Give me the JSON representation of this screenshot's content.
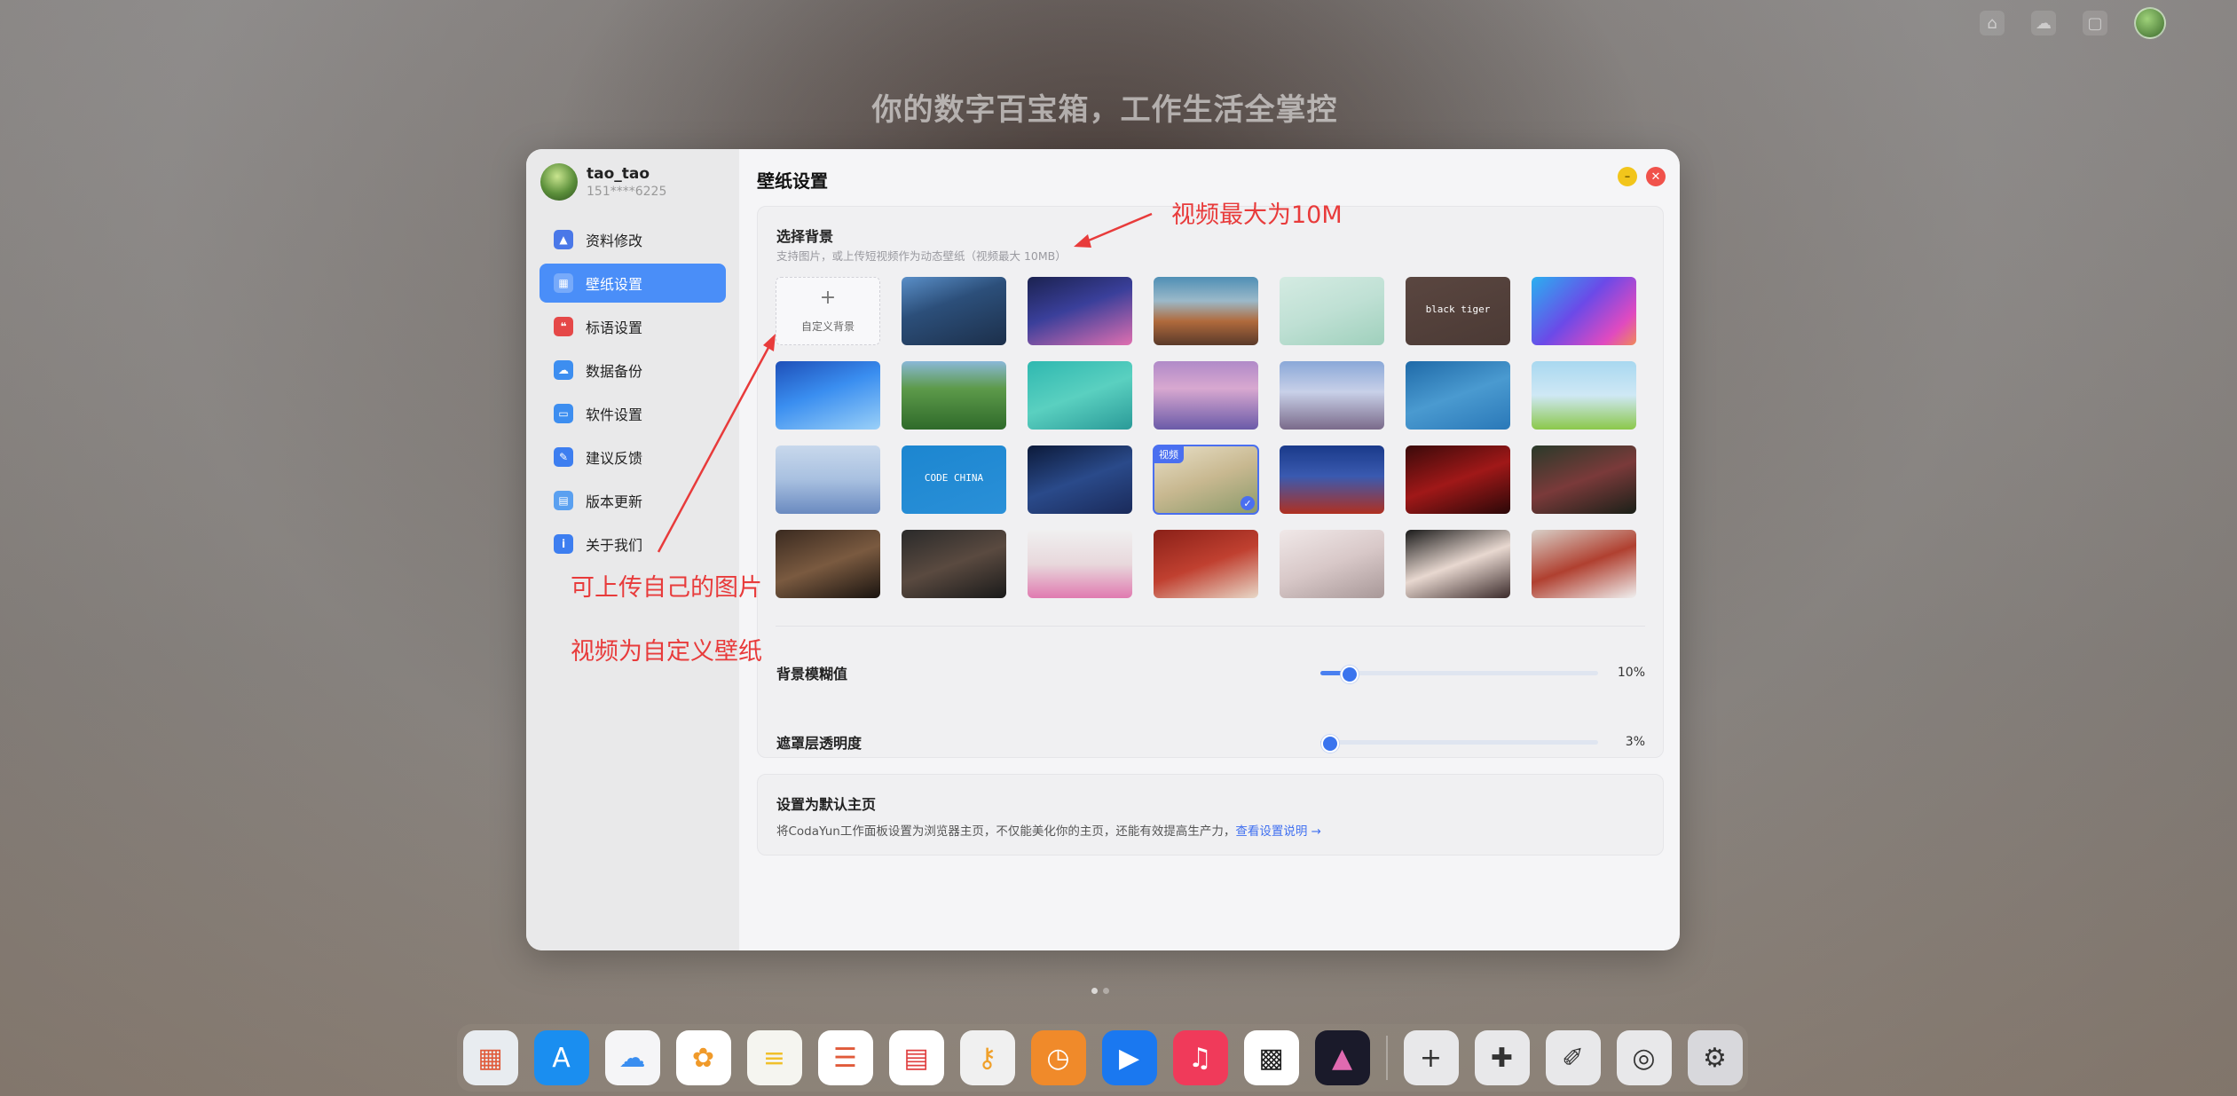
{
  "slogan": "你的数字百宝箱，工作生活全掌控",
  "profile": {
    "name": "tao_tao",
    "phone": "151****6225"
  },
  "menu": [
    {
      "label": "资料修改",
      "icon": "user-edit-icon",
      "color": "#4a78e8",
      "glyph": "▲",
      "active": false
    },
    {
      "label": "壁纸设置",
      "icon": "wallpaper-icon",
      "color": "#ffffff",
      "glyph": "▦",
      "active": true
    },
    {
      "label": "标语设置",
      "icon": "quote-icon",
      "color": "#e54848",
      "glyph": "❝",
      "active": false
    },
    {
      "label": "数据备份",
      "icon": "cloud-icon",
      "color": "#3d8ef0",
      "glyph": "☁",
      "active": false
    },
    {
      "label": "软件设置",
      "icon": "computer-icon",
      "color": "#3d8ef0",
      "glyph": "▭",
      "active": false
    },
    {
      "label": "建议反馈",
      "icon": "feedback-icon",
      "color": "#3d7ef0",
      "glyph": "✎",
      "active": false
    },
    {
      "label": "版本更新",
      "icon": "update-icon",
      "color": "#5aa0f0",
      "glyph": "▤",
      "active": false
    },
    {
      "label": "关于我们",
      "icon": "info-icon",
      "color": "#3d7ef0",
      "glyph": "i",
      "active": false
    }
  ],
  "main": {
    "title": "壁纸设置",
    "select": {
      "title": "选择背景",
      "subtitle": "支持图片，或上传短视频作为动态壁纸（视频最大 10MB）",
      "add_label": "自定义背景",
      "add_plus": "+",
      "video_badge": "视频",
      "selected_index": 24,
      "tiles": [
        {
          "name": "anime-city",
          "bg": "linear-gradient(160deg,#5a8fc8 0%,#2c4f7a 40%,#1c2f4a 100%)"
        },
        {
          "name": "neon-night-city",
          "bg": "linear-gradient(160deg,#1b2250 0%,#3a3f9a 45%,#e06fb0 100%)"
        },
        {
          "name": "mountain-sunset",
          "bg": "linear-gradient(180deg,#4f8fb5 0%,#9bb9c9 35%,#b06a3c 65%,#5a3a2a 100%)"
        },
        {
          "name": "green-cartoon",
          "bg": "linear-gradient(160deg,#d4ebe2 0%,#bfe0d4 50%,#9fd0bc 100%)"
        },
        {
          "name": "black-tiger-text",
          "bg": "linear-gradient(160deg,#5a4640 0%,#4b3a35 100%)",
          "text": "black tiger"
        },
        {
          "name": "purple-gradient",
          "bg": "linear-gradient(135deg,#2ab0f0 0%,#6b4ae8 45%,#e04ac0 80%,#f08a5a 100%)"
        },
        {
          "name": "blue-waves",
          "bg": "linear-gradient(160deg,#1e4fb8 0%,#3a8ef0 45%,#9ad0f8 100%)"
        },
        {
          "name": "green-forest",
          "bg": "linear-gradient(180deg,#8ab8d8 0%,#5d9a4a 40%,#2f6a2a 100%)"
        },
        {
          "name": "teal-texture",
          "bg": "linear-gradient(160deg,#2fb8b0 0%,#5ad0c0 50%,#2a9a98 100%)"
        },
        {
          "name": "mount-fuji-purple",
          "bg": "linear-gradient(180deg,#b08ac8 0%,#d8a8d0 40%,#6a5aa8 100%)"
        },
        {
          "name": "mount-fuji-sakura",
          "bg": "linear-gradient(180deg,#8aa8d8 0%,#c8d0e8 45%,#7a6a8a 100%)"
        },
        {
          "name": "blue-water",
          "bg": "linear-gradient(160deg,#1f6aa8 0%,#4a9ad0 50%,#2a78b8 100%)"
        },
        {
          "name": "pixel-cartoon",
          "bg": "linear-gradient(180deg,#a8d8f0 0%,#cfe8f5 50%,#8bc84a 100%)"
        },
        {
          "name": "misty-mountains",
          "bg": "linear-gradient(180deg,#c8d8ec 0%,#a8c0e0 50%,#6a8ac0 100%)"
        },
        {
          "name": "code-screen",
          "bg": "linear-gradient(160deg,#1c86d0 0%,#2a90d8 100%)",
          "text": "CODE CHINA"
        },
        {
          "name": "stage-concert",
          "bg": "linear-gradient(160deg,#0c1a3a 0%,#2a4a8a 50%,#1a2a5a 100%)"
        },
        {
          "name": "girl-video",
          "bg": "linear-gradient(160deg,#e8e0c8 0%,#c8b890 50%,#8a9a6a 100%)"
        },
        {
          "name": "tiananmen",
          "bg": "linear-gradient(180deg,#1a3a8a 0%,#3a5ab0 45%,#b03020 100%)"
        },
        {
          "name": "red-dark",
          "bg": "linear-gradient(160deg,#3a0a0a 0%,#a01818 50%,#2a0808 100%)"
        },
        {
          "name": "woman-red-dress",
          "bg": "linear-gradient(160deg,#2a3a2a 0%,#7a3a3a 50%,#1a2018 100%)"
        },
        {
          "name": "woman-portrait-dark",
          "bg": "linear-gradient(160deg,#3a2a20 0%,#7a5a40 50%,#1a1410 100%)"
        },
        {
          "name": "woman-black",
          "bg": "linear-gradient(160deg,#2a2a2a 0%,#5a4a40 50%,#1a1a1a 100%)"
        },
        {
          "name": "woman-pink",
          "bg": "linear-gradient(180deg,#f0f0f0 0%,#e8d8dc 50%,#e07ab0 100%)"
        },
        {
          "name": "cat-red-corridor",
          "bg": "linear-gradient(160deg,#8a2018 0%,#c04030 50%,#e8d8c8 100%)"
        },
        {
          "name": "woman-white",
          "bg": "linear-gradient(160deg,#f0e8e8 0%,#d8c8c8 50%,#a89898 100%)"
        },
        {
          "name": "woman-hanfu",
          "bg": "linear-gradient(160deg,#1a1a1a 0%,#e8d8d0 50%,#3a2a2a 100%)"
        },
        {
          "name": "cat-snow",
          "bg": "linear-gradient(160deg,#d8d0c8 0%,#b04030 50%,#f0f0f0 100%)"
        }
      ]
    },
    "blur": {
      "label": "背景模糊值",
      "value": 10,
      "display": "10%"
    },
    "overlay": {
      "label": "遮罩层透明度",
      "value": 3,
      "display": "3%"
    },
    "default_home": {
      "title": "设置为默认主页",
      "desc": "将CodaYun工作面板设置为浏览器主页，不仅能美化你的主页，还能有效提高生产力，",
      "link": "查看设置说明 →"
    }
  },
  "annotations": {
    "video_max": "视频最大为10M",
    "upload_own": "可上传自己的图片",
    "video_custom": "视频为自定义壁纸"
  },
  "dock": [
    {
      "name": "launchpad-icon",
      "bg": "#e8ecf0",
      "glyph": "▦",
      "color": "#e05a3a"
    },
    {
      "name": "appstore-icon",
      "bg": "#1a8ef0",
      "glyph": "A",
      "color": "#ffffff"
    },
    {
      "name": "icloud-icon",
      "bg": "#f5f5f7",
      "glyph": "☁",
      "color": "#3a8ef0"
    },
    {
      "name": "photos-icon",
      "bg": "#ffffff",
      "glyph": "✿",
      "color": "#f09a2a"
    },
    {
      "name": "notes-icon",
      "bg": "#f5f5f0",
      "glyph": "≡",
      "color": "#f0c02a"
    },
    {
      "name": "reminders-icon",
      "bg": "#ffffff",
      "glyph": "☰",
      "color": "#e05a3a"
    },
    {
      "name": "calendar-icon",
      "bg": "#ffffff",
      "glyph": "▤",
      "color": "#e04040"
    },
    {
      "name": "keychain-icon",
      "bg": "#f0f0f0",
      "glyph": "⚷",
      "color": "#f0a02a"
    },
    {
      "name": "clock-icon",
      "bg": "#f08a2a",
      "glyph": "◷",
      "color": "#ffffff"
    },
    {
      "name": "play-icon",
      "bg": "#1a78f0",
      "glyph": "▶",
      "color": "#ffffff"
    },
    {
      "name": "music-icon",
      "bg": "#f03a5a",
      "glyph": "♫",
      "color": "#ffffff"
    },
    {
      "name": "qrcode-icon",
      "bg": "#ffffff",
      "glyph": "▩",
      "color": "#222222"
    },
    {
      "name": "gallery-icon",
      "bg": "#1a1a2a",
      "glyph": "▲",
      "color": "#e06ab0"
    },
    {
      "name": "add-icon",
      "bg": "#e8e8ea",
      "glyph": "+",
      "color": "#333333"
    },
    {
      "name": "puzzle-icon",
      "bg": "#e8e8ea",
      "glyph": "✚",
      "color": "#333333"
    },
    {
      "name": "brush-icon",
      "bg": "#e8e8ea",
      "glyph": "✐",
      "color": "#333333"
    },
    {
      "name": "pin-icon",
      "bg": "#e8e8ea",
      "glyph": "◎",
      "color": "#333333"
    },
    {
      "name": "settings-icon",
      "bg": "#d8d8dc",
      "glyph": "⚙",
      "color": "#333333"
    }
  ]
}
